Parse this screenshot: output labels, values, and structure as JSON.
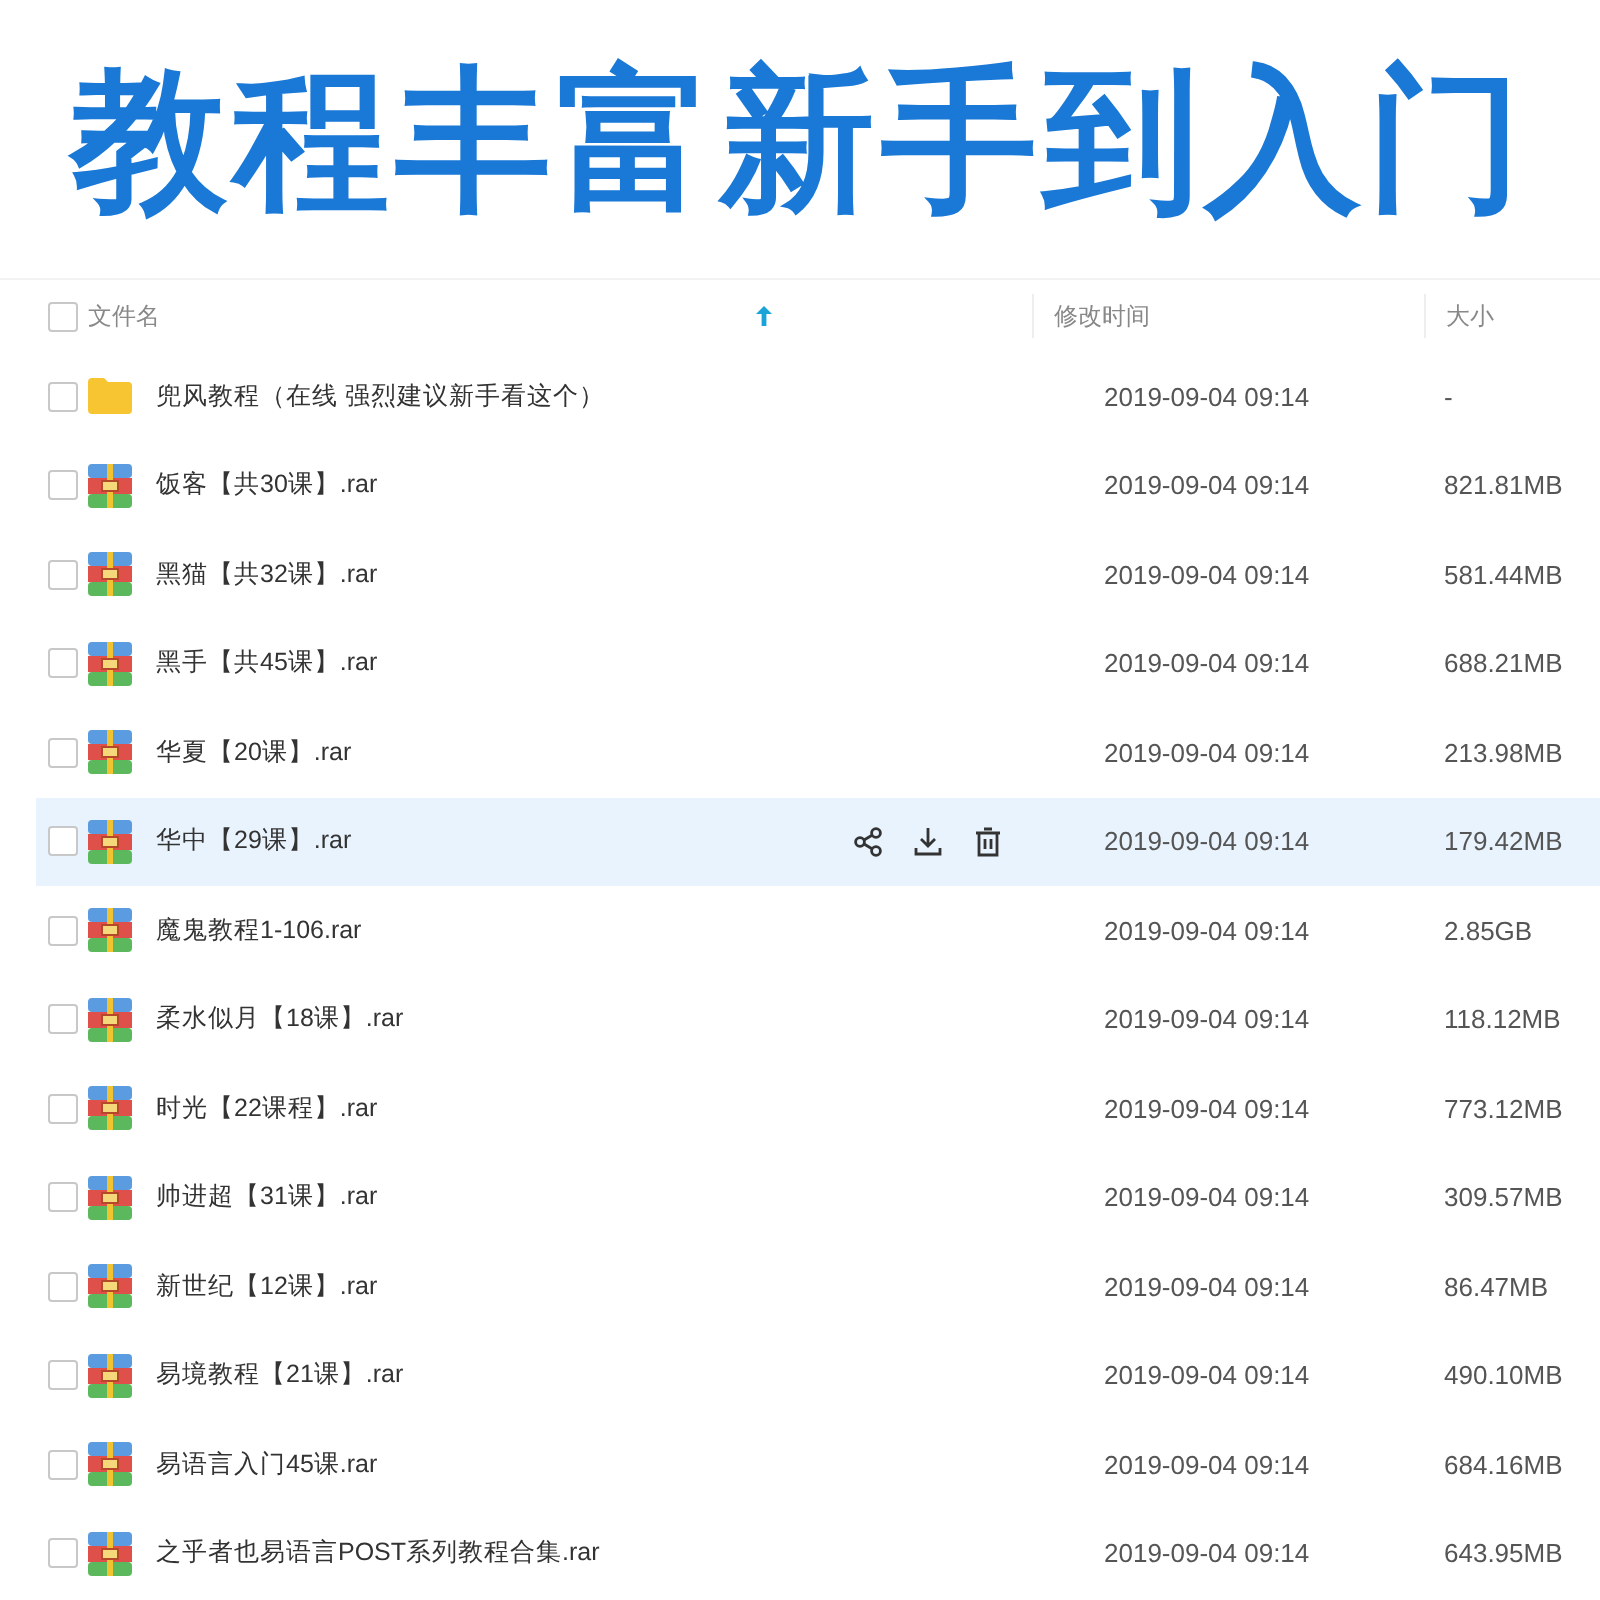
{
  "banner": {
    "title": "教程丰富新手到入门"
  },
  "table": {
    "select_all": {
      "checked": false
    },
    "columns": [
      {
        "label": "文件名",
        "sorted": true
      },
      {
        "label": "修改时间",
        "sorted": false
      },
      {
        "label": "大小",
        "sorted": false
      }
    ],
    "rows": [
      {
        "kind": "folder",
        "name": "兜风教程（在线 强烈建议新手看这个）",
        "modified": "2019-09-04 09:14",
        "size": "-",
        "checked": false,
        "hovered": false
      },
      {
        "kind": "archive",
        "name": "饭客【共30课】.rar",
        "modified": "2019-09-04 09:14",
        "size": "821.81MB",
        "checked": false,
        "hovered": false
      },
      {
        "kind": "archive",
        "name": "黑猫【共32课】.rar",
        "modified": "2019-09-04 09:14",
        "size": "581.44MB",
        "checked": false,
        "hovered": false
      },
      {
        "kind": "archive",
        "name": "黑手【共45课】.rar",
        "modified": "2019-09-04 09:14",
        "size": "688.21MB",
        "checked": false,
        "hovered": false
      },
      {
        "kind": "archive",
        "name": "华夏【20课】.rar",
        "modified": "2019-09-04 09:14",
        "size": "213.98MB",
        "checked": false,
        "hovered": false
      },
      {
        "kind": "archive",
        "name": "华中【29课】.rar",
        "modified": "2019-09-04 09:14",
        "size": "179.42MB",
        "checked": false,
        "hovered": true
      },
      {
        "kind": "archive",
        "name": "魔鬼教程1-106.rar",
        "modified": "2019-09-04 09:14",
        "size": "2.85GB",
        "checked": false,
        "hovered": false
      },
      {
        "kind": "archive",
        "name": "柔水似月【18课】.rar",
        "modified": "2019-09-04 09:14",
        "size": "118.12MB",
        "checked": false,
        "hovered": false
      },
      {
        "kind": "archive",
        "name": "时光【22课程】.rar",
        "modified": "2019-09-04 09:14",
        "size": "773.12MB",
        "checked": false,
        "hovered": false
      },
      {
        "kind": "archive",
        "name": "帅进超【31课】.rar",
        "modified": "2019-09-04 09:14",
        "size": "309.57MB",
        "checked": false,
        "hovered": false
      },
      {
        "kind": "archive",
        "name": "新世纪【12课】.rar",
        "modified": "2019-09-04 09:14",
        "size": "86.47MB",
        "checked": false,
        "hovered": false
      },
      {
        "kind": "archive",
        "name": "易境教程【21课】.rar",
        "modified": "2019-09-04 09:14",
        "size": "490.10MB",
        "checked": false,
        "hovered": false
      },
      {
        "kind": "archive",
        "name": "易语言入门45课.rar",
        "modified": "2019-09-04 09:14",
        "size": "684.16MB",
        "checked": false,
        "hovered": false
      },
      {
        "kind": "archive",
        "name": "之乎者也易语言POST系列教程合集.rar",
        "modified": "2019-09-04 09:14",
        "size": "643.95MB",
        "checked": false,
        "hovered": false
      }
    ]
  }
}
